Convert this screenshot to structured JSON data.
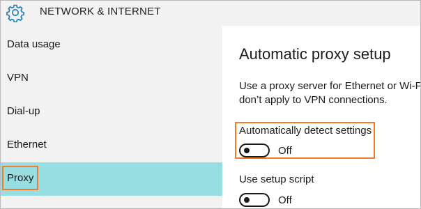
{
  "header": {
    "title": "NETWORK & INTERNET",
    "icon": "gear-icon"
  },
  "sidebar": {
    "items": [
      {
        "label": "Data usage",
        "selected": false
      },
      {
        "label": "VPN",
        "selected": false
      },
      {
        "label": "Dial-up",
        "selected": false
      },
      {
        "label": "Ethernet",
        "selected": false
      },
      {
        "label": "Proxy",
        "selected": true
      }
    ]
  },
  "main": {
    "heading": "Automatic proxy setup",
    "description_line1": "Use a proxy server for Ethernet or Wi-Fi",
    "description_line2": "don’t apply to VPN connections.",
    "auto_detect": {
      "label": "Automatically detect settings",
      "state": "Off"
    },
    "setup_script": {
      "label": "Use setup script",
      "state": "Off"
    }
  },
  "colors": {
    "accent_selection": "#97dde2",
    "highlight_outline": "#ee7d29",
    "icon_blue": "#1a7ab8"
  }
}
